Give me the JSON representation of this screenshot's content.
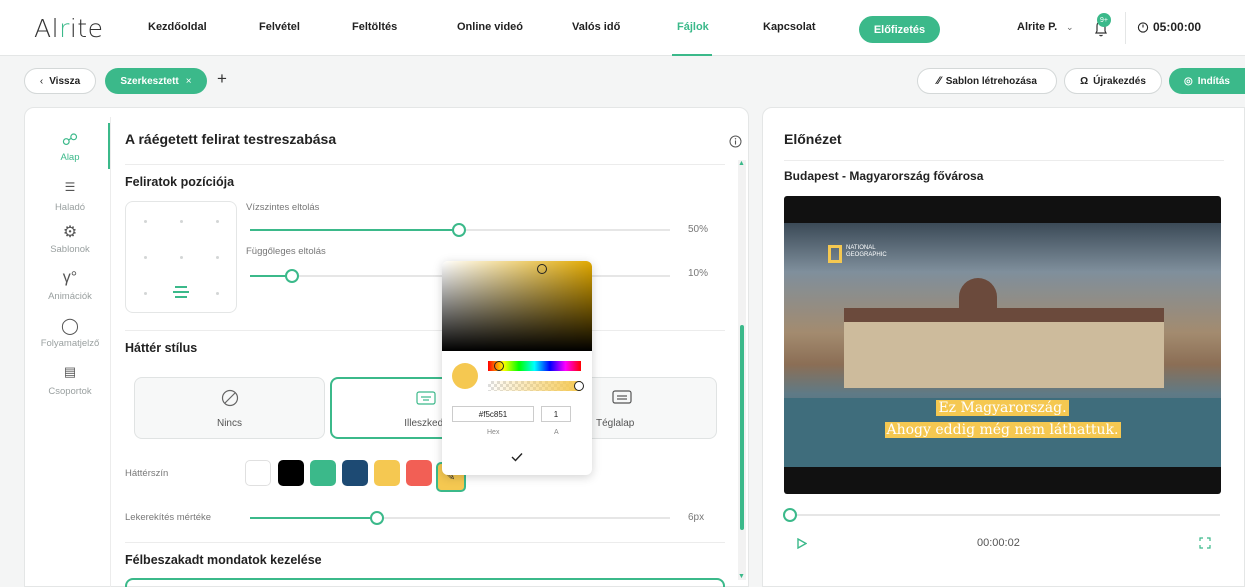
{
  "app": {
    "logo_a": "Al",
    "logo_b": "r",
    "logo_c": "ite"
  },
  "nav": {
    "items": [
      "Kezdőoldal",
      "Felvétel",
      "Feltöltés",
      "Online videó",
      "Valós idő",
      "Fájlok",
      "Kapcsolat"
    ],
    "active": "Fájlok",
    "subscribe": "Előfizetés",
    "user": "Alrite P.",
    "badge": "9+",
    "timer": "05:00:00"
  },
  "toolbar": {
    "back": "Vissza",
    "tab": "Szerkesztett",
    "template": "Sablon létrehozása",
    "restart": "Újrakezdés",
    "start": "Indítás"
  },
  "sidebar": {
    "items": [
      {
        "label": "Alap",
        "icon": "palette-icon"
      },
      {
        "label": "Haladó",
        "icon": "settings-sliders-icon"
      },
      {
        "label": "Sablonok",
        "icon": "gear-icon"
      },
      {
        "label": "Animációk",
        "icon": "animation-icon"
      },
      {
        "label": "Folyamatjelző",
        "icon": "progress-icon"
      },
      {
        "label": "Csoportok",
        "icon": "groups-icon"
      }
    ],
    "active": "Alap"
  },
  "editor": {
    "title": "A ráégetett felirat testreszabása",
    "position_title": "Feliratok pozíciója",
    "h_offset_label": "Vízszintes eltolás",
    "h_offset_value": "50%",
    "h_offset": 0.5,
    "v_offset_label": "Függőleges eltolás",
    "v_offset_value": "10%",
    "v_offset": 0.1,
    "bg_style_title": "Háttér stílus",
    "styles": [
      "Nincs",
      "Illeszkedő",
      "Téglalap"
    ],
    "selected_style": "Illeszkedő",
    "bg_color_label": "Háttérszín",
    "swatches": [
      "#ffffff",
      "#000000",
      "#3bb98a",
      "#1d4a73",
      "#f5c851",
      "#f25f55"
    ],
    "radius_label": "Lekerekítés mértéke",
    "radius_value": "6px",
    "broken_title": "Félbeszakadt mondatok kezelése"
  },
  "picker": {
    "hex": "#f5c851",
    "alpha": "1",
    "hex_label": "Hex",
    "alpha_label": "A",
    "color": "#f5c851"
  },
  "preview": {
    "title": "Előnézet",
    "video_title": "Budapest - Magyarország fővárosa",
    "brand": "NATIONAL GEOGRAPHIC",
    "subtitle_1": "Ez Magyarország.",
    "subtitle_2": "Ahogy eddig még nem láthattuk.",
    "time": "00:00:02"
  }
}
